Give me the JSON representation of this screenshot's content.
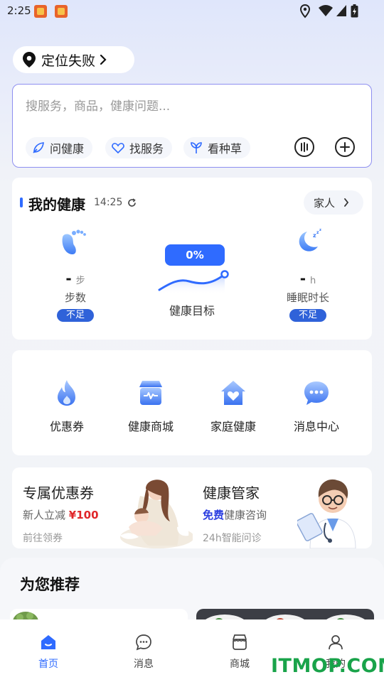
{
  "status_bar": {
    "time": "2:25"
  },
  "location": {
    "label": "定位失败"
  },
  "search": {
    "placeholder": "搜服务，商品，健康问题...",
    "pills": [
      "问健康",
      "找服务",
      "看种草"
    ]
  },
  "health": {
    "title": "我的健康",
    "time": "14:25",
    "family_label": "家人",
    "steps": {
      "value": "-",
      "unit": "步",
      "name": "步数",
      "badge": "不足"
    },
    "goal": {
      "percent": "0%",
      "name": "健康目标"
    },
    "sleep": {
      "value": "-",
      "unit": "h",
      "name": "睡眠时长",
      "badge": "不足"
    }
  },
  "quick_access": [
    {
      "label": "优惠券",
      "icon": "flame-icon"
    },
    {
      "label": "健康商城",
      "icon": "store-icon"
    },
    {
      "label": "家庭健康",
      "icon": "home-heart-icon"
    },
    {
      "label": "消息中心",
      "icon": "chat-bubble-icon"
    }
  ],
  "promos": {
    "coupon": {
      "title": "专属优惠券",
      "sub_prefix": "新人立减 ",
      "sub_highlight": "¥100",
      "action": "前往领券"
    },
    "butler": {
      "title": "健康管家",
      "sub_highlight": "免费",
      "sub_suffix": "健康咨询",
      "action": "24h智能问诊"
    }
  },
  "recommend": {
    "title": "为您推荐"
  },
  "bottom_nav": [
    {
      "label": "首页",
      "icon": "home-icon",
      "active": true
    },
    {
      "label": "消息",
      "icon": "message-icon",
      "active": false
    },
    {
      "label": "商城",
      "icon": "mall-icon",
      "active": false
    },
    {
      "label": "我的",
      "icon": "profile-icon",
      "active": false
    }
  ],
  "watermark": "ITMOP.COM",
  "colors": {
    "accent": "#2f6bff",
    "badge": "#2f62d9",
    "price_red": "#e0262a",
    "free_blue": "#2b3ee0",
    "watermark_green": "#19a34a"
  }
}
